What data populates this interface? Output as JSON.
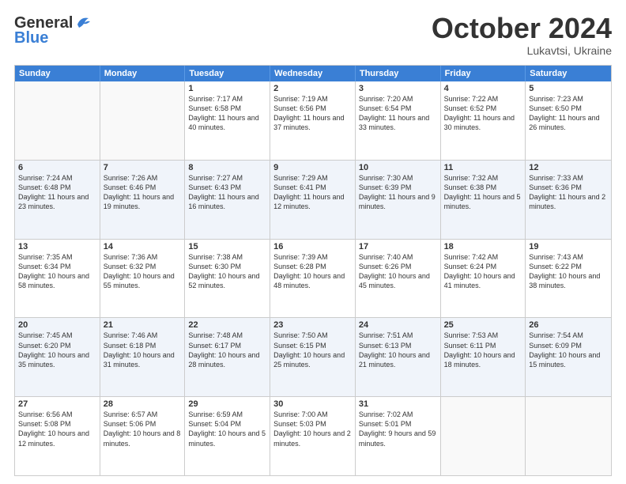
{
  "header": {
    "logo_general": "General",
    "logo_blue": "Blue",
    "month": "October 2024",
    "location": "Lukavtsi, Ukraine"
  },
  "weekdays": [
    "Sunday",
    "Monday",
    "Tuesday",
    "Wednesday",
    "Thursday",
    "Friday",
    "Saturday"
  ],
  "rows": [
    [
      {
        "day": "",
        "text": ""
      },
      {
        "day": "",
        "text": ""
      },
      {
        "day": "1",
        "text": "Sunrise: 7:17 AM\nSunset: 6:58 PM\nDaylight: 11 hours and 40 minutes."
      },
      {
        "day": "2",
        "text": "Sunrise: 7:19 AM\nSunset: 6:56 PM\nDaylight: 11 hours and 37 minutes."
      },
      {
        "day": "3",
        "text": "Sunrise: 7:20 AM\nSunset: 6:54 PM\nDaylight: 11 hours and 33 minutes."
      },
      {
        "day": "4",
        "text": "Sunrise: 7:22 AM\nSunset: 6:52 PM\nDaylight: 11 hours and 30 minutes."
      },
      {
        "day": "5",
        "text": "Sunrise: 7:23 AM\nSunset: 6:50 PM\nDaylight: 11 hours and 26 minutes."
      }
    ],
    [
      {
        "day": "6",
        "text": "Sunrise: 7:24 AM\nSunset: 6:48 PM\nDaylight: 11 hours and 23 minutes."
      },
      {
        "day": "7",
        "text": "Sunrise: 7:26 AM\nSunset: 6:46 PM\nDaylight: 11 hours and 19 minutes."
      },
      {
        "day": "8",
        "text": "Sunrise: 7:27 AM\nSunset: 6:43 PM\nDaylight: 11 hours and 16 minutes."
      },
      {
        "day": "9",
        "text": "Sunrise: 7:29 AM\nSunset: 6:41 PM\nDaylight: 11 hours and 12 minutes."
      },
      {
        "day": "10",
        "text": "Sunrise: 7:30 AM\nSunset: 6:39 PM\nDaylight: 11 hours and 9 minutes."
      },
      {
        "day": "11",
        "text": "Sunrise: 7:32 AM\nSunset: 6:38 PM\nDaylight: 11 hours and 5 minutes."
      },
      {
        "day": "12",
        "text": "Sunrise: 7:33 AM\nSunset: 6:36 PM\nDaylight: 11 hours and 2 minutes."
      }
    ],
    [
      {
        "day": "13",
        "text": "Sunrise: 7:35 AM\nSunset: 6:34 PM\nDaylight: 10 hours and 58 minutes."
      },
      {
        "day": "14",
        "text": "Sunrise: 7:36 AM\nSunset: 6:32 PM\nDaylight: 10 hours and 55 minutes."
      },
      {
        "day": "15",
        "text": "Sunrise: 7:38 AM\nSunset: 6:30 PM\nDaylight: 10 hours and 52 minutes."
      },
      {
        "day": "16",
        "text": "Sunrise: 7:39 AM\nSunset: 6:28 PM\nDaylight: 10 hours and 48 minutes."
      },
      {
        "day": "17",
        "text": "Sunrise: 7:40 AM\nSunset: 6:26 PM\nDaylight: 10 hours and 45 minutes."
      },
      {
        "day": "18",
        "text": "Sunrise: 7:42 AM\nSunset: 6:24 PM\nDaylight: 10 hours and 41 minutes."
      },
      {
        "day": "19",
        "text": "Sunrise: 7:43 AM\nSunset: 6:22 PM\nDaylight: 10 hours and 38 minutes."
      }
    ],
    [
      {
        "day": "20",
        "text": "Sunrise: 7:45 AM\nSunset: 6:20 PM\nDaylight: 10 hours and 35 minutes."
      },
      {
        "day": "21",
        "text": "Sunrise: 7:46 AM\nSunset: 6:18 PM\nDaylight: 10 hours and 31 minutes."
      },
      {
        "day": "22",
        "text": "Sunrise: 7:48 AM\nSunset: 6:17 PM\nDaylight: 10 hours and 28 minutes."
      },
      {
        "day": "23",
        "text": "Sunrise: 7:50 AM\nSunset: 6:15 PM\nDaylight: 10 hours and 25 minutes."
      },
      {
        "day": "24",
        "text": "Sunrise: 7:51 AM\nSunset: 6:13 PM\nDaylight: 10 hours and 21 minutes."
      },
      {
        "day": "25",
        "text": "Sunrise: 7:53 AM\nSunset: 6:11 PM\nDaylight: 10 hours and 18 minutes."
      },
      {
        "day": "26",
        "text": "Sunrise: 7:54 AM\nSunset: 6:09 PM\nDaylight: 10 hours and 15 minutes."
      }
    ],
    [
      {
        "day": "27",
        "text": "Sunrise: 6:56 AM\nSunset: 5:08 PM\nDaylight: 10 hours and 12 minutes."
      },
      {
        "day": "28",
        "text": "Sunrise: 6:57 AM\nSunset: 5:06 PM\nDaylight: 10 hours and 8 minutes."
      },
      {
        "day": "29",
        "text": "Sunrise: 6:59 AM\nSunset: 5:04 PM\nDaylight: 10 hours and 5 minutes."
      },
      {
        "day": "30",
        "text": "Sunrise: 7:00 AM\nSunset: 5:03 PM\nDaylight: 10 hours and 2 minutes."
      },
      {
        "day": "31",
        "text": "Sunrise: 7:02 AM\nSunset: 5:01 PM\nDaylight: 9 hours and 59 minutes."
      },
      {
        "day": "",
        "text": ""
      },
      {
        "day": "",
        "text": ""
      }
    ]
  ]
}
